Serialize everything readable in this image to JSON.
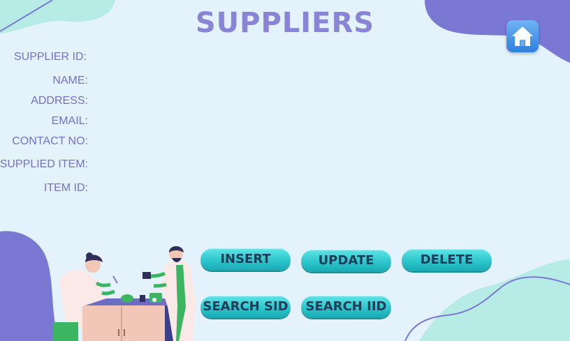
{
  "page": {
    "title": "SUPPLIERS"
  },
  "form": {
    "labels": [
      "SUPPLIER ID:",
      "NAME:",
      "ADDRESS:",
      "EMAIL:",
      "CONTACT NO:",
      "SUPPLIED ITEM:",
      "ITEM ID:"
    ]
  },
  "buttons": {
    "insert": "INSERT",
    "update": "UPDATE",
    "delete": "DELETE",
    "search_sid": "SEARCH SID",
    "search_iid": "SEARCH IID"
  },
  "colors": {
    "background": "#e4f2fc",
    "title": "#8a84d6",
    "label": "#7570c8",
    "blob_purple": "#7a78d2",
    "blob_mint": "#b7ece6",
    "button": "#2cc6cc"
  },
  "icons": {
    "home": "home-icon"
  }
}
